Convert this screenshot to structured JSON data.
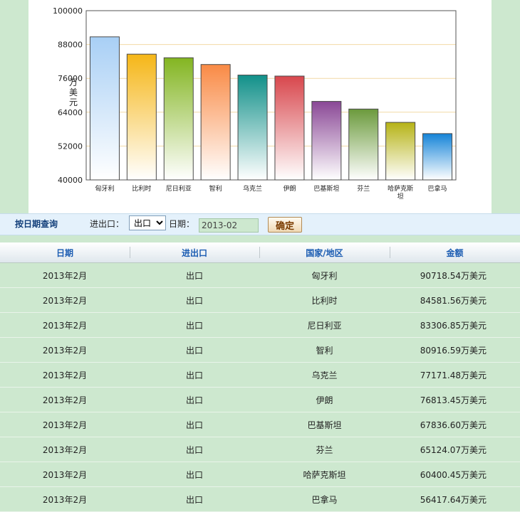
{
  "chart_data": {
    "type": "bar",
    "title": "",
    "xlabel": "",
    "ylabel": "万美元",
    "ylim": [
      40000,
      100000
    ],
    "yticks": [
      40000,
      52000,
      64000,
      76000,
      88000,
      100000
    ],
    "grid": true,
    "categories": [
      "匈牙利",
      "比利时",
      "尼日利亚",
      "智利",
      "乌克兰",
      "伊朗",
      "巴基斯坦",
      "芬兰",
      "哈萨克斯坦",
      "巴拿马"
    ],
    "values": [
      90718.54,
      84581.56,
      83306.85,
      80916.59,
      77171.48,
      76813.45,
      67836.6,
      65124.07,
      60400.45,
      56417.64
    ],
    "colors": [
      "#a8cff5",
      "#f5b617",
      "#83b521",
      "#f98a45",
      "#119089",
      "#d8474d",
      "#8a4896",
      "#6b9a3c",
      "#b6b316",
      "#1584d8"
    ]
  },
  "query": {
    "title": "按日期查询",
    "type_label": "进出口：",
    "type_value": "出口",
    "date_label": "日期：",
    "date_value": "2013-02",
    "confirm_label": "确定"
  },
  "table": {
    "headers": [
      "日期",
      "进出口",
      "国家/地区",
      "金额"
    ],
    "rows": [
      [
        "2013年2月",
        "出口",
        "匈牙利",
        "90718.54万美元"
      ],
      [
        "2013年2月",
        "出口",
        "比利时",
        "84581.56万美元"
      ],
      [
        "2013年2月",
        "出口",
        "尼日利亚",
        "83306.85万美元"
      ],
      [
        "2013年2月",
        "出口",
        "智利",
        "80916.59万美元"
      ],
      [
        "2013年2月",
        "出口",
        "乌克兰",
        "77171.48万美元"
      ],
      [
        "2013年2月",
        "出口",
        "伊朗",
        "76813.45万美元"
      ],
      [
        "2013年2月",
        "出口",
        "巴基斯坦",
        "67836.60万美元"
      ],
      [
        "2013年2月",
        "出口",
        "芬兰",
        "65124.07万美元"
      ],
      [
        "2013年2月",
        "出口",
        "哈萨克斯坦",
        "60400.45万美元"
      ],
      [
        "2013年2月",
        "出口",
        "巴拿马",
        "56417.64万美元"
      ]
    ]
  }
}
